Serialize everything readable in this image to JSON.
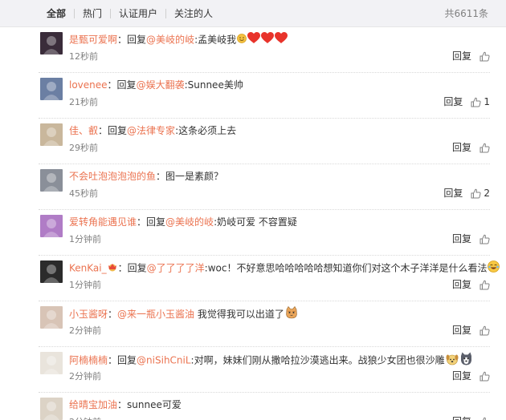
{
  "filters": {
    "tabs": [
      "全部",
      "热门",
      "认证用户",
      "关注的人"
    ],
    "total": "共6611条"
  },
  "comments": [
    {
      "user": "是甄可爱啊",
      "sep": "：",
      "reply_prefix": "回复",
      "mention": "@美岐的岐",
      "text": ":孟美岐我",
      "time": "12秒前",
      "reply_label": "回复",
      "likes": "",
      "emojis": [
        "smile",
        "heart",
        "heart",
        "heart"
      ],
      "avatar_color": "#3a2c3a"
    },
    {
      "user": "lovenee",
      "sep": "：",
      "reply_prefix": "回复",
      "mention": "@娱大翻袭",
      "text": ":Sunnee美帅",
      "time": "21秒前",
      "reply_label": "回复",
      "likes": "1",
      "emojis": [],
      "avatar_color": "#6b7fa3"
    },
    {
      "user": "佳、叡",
      "sep": "：",
      "reply_prefix": "回复",
      "mention": "@法律专家",
      "text": ":这条必须上去",
      "time": "29秒前",
      "reply_label": "回复",
      "likes": "",
      "emojis": [],
      "avatar_color": "#c9b79c"
    },
    {
      "user": "不会吐泡泡泡泡的鱼",
      "sep": "：",
      "reply_prefix": "",
      "mention": "",
      "text": "图一是素颜？",
      "time": "45秒前",
      "reply_label": "回复",
      "likes": "2",
      "emojis": [],
      "avatar_color": "#8a8f99"
    },
    {
      "user": "爱转角能遇见谁",
      "sep": "：",
      "reply_prefix": "回复",
      "mention": "@美岐的岐",
      "text": ":奶岐可爱 不容置疑",
      "time": "1分钟前",
      "reply_label": "回复",
      "likes": "",
      "emojis": [],
      "avatar_color": "#b07cc6"
    },
    {
      "user": "KenKai_",
      "sep": "：",
      "reply_prefix": "回复",
      "mention": "@了了了了洋",
      "text": ":woc！不好意思哈哈哈哈哈想知道你们对这个木子洋洋是什么看法",
      "time": "1分钟前",
      "reply_label": "回复",
      "likes": "",
      "emojis": [
        "laugh"
      ],
      "avatar_color": "#2b2b2b"
    },
    {
      "user": "小玉酱呀",
      "sep": "：",
      "reply_prefix": "",
      "mention": "@来一瓶小玉酱油",
      "text": " 我觉得我可以出道了",
      "time": "2分钟前",
      "reply_label": "回复",
      "likes": "",
      "emojis": [
        "cat"
      ],
      "avatar_color": "#d8c4b6"
    },
    {
      "user": "阿楠楠楠",
      "sep": "：",
      "reply_prefix": "回复",
      "mention": "@niSihCniL",
      "text": ":对啊，妹妹们刚从撒哈拉沙漠逃出来。战狼少女团也很沙雕",
      "time": "2分钟前",
      "reply_label": "回复",
      "likes": "",
      "emojis": [
        "dog",
        "husky"
      ],
      "avatar_color": "#e9e4dc"
    },
    {
      "user": "给晴宝加油",
      "sep": "：",
      "reply_prefix": "",
      "mention": "",
      "text": "sunnee可爱",
      "time": "2分钟前",
      "reply_label": "回复",
      "likes": "",
      "emojis": [],
      "avatar_color": "#dcd3c6"
    }
  ],
  "colors": {
    "accent": "#eb7350",
    "heart": "#e8332b"
  }
}
